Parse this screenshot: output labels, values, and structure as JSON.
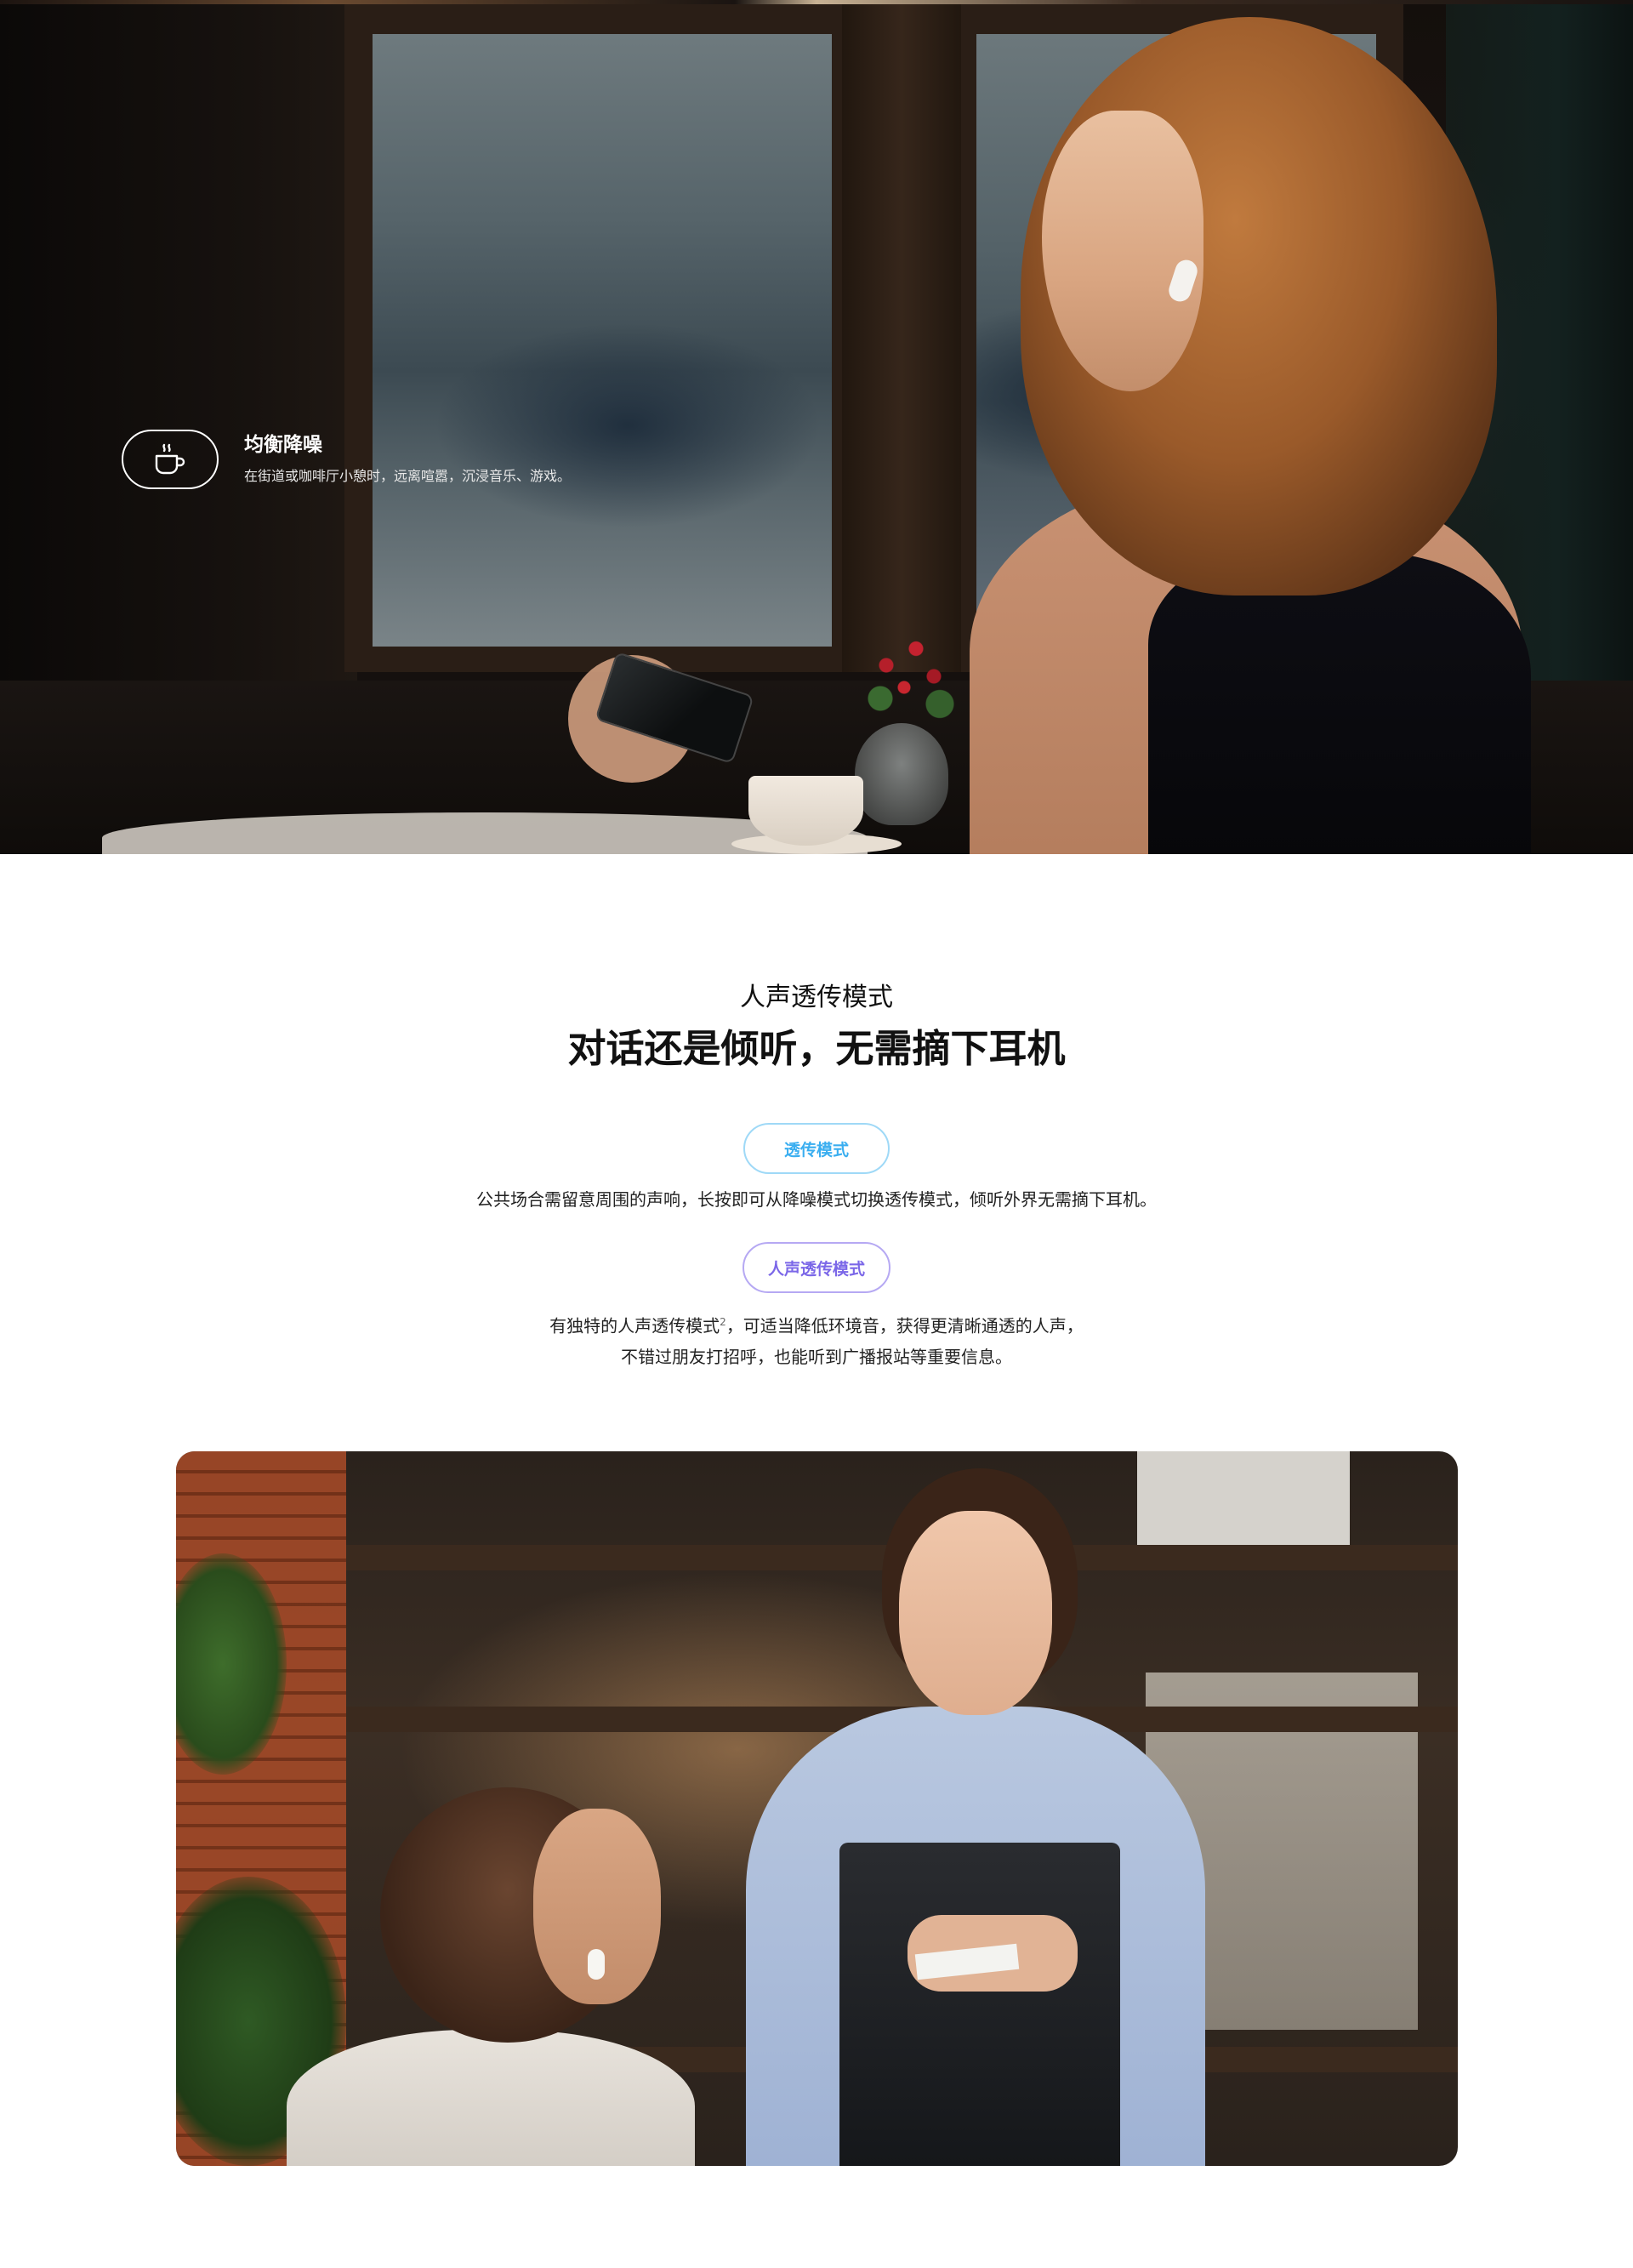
{
  "hero": {
    "icon": "coffee-cup-icon",
    "title": "均衡降噪",
    "description": "在街道或咖啡厅小憩时，远离喧嚣，沉浸音乐、游戏。"
  },
  "transparency": {
    "kicker": "人声透传模式",
    "title": "对话还是倾听，无需摘下耳机",
    "modes": [
      {
        "label": "透传模式",
        "color": "#3aaef0",
        "description": "公共场合需留意周围的声响，长按即可从降噪模式切换透传模式，倾听外界无需摘下耳机。"
      },
      {
        "label": "人声透传模式",
        "color": "#7b67e8",
        "description_line1_pre": "有独特的人声透传模式",
        "footnote": "2",
        "description_line1_post": "，可适当降低环境音，获得更清晰通透的人声，",
        "description_line2": "不错过朋友打招呼，也能听到广播报站等重要信息。"
      }
    ]
  }
}
